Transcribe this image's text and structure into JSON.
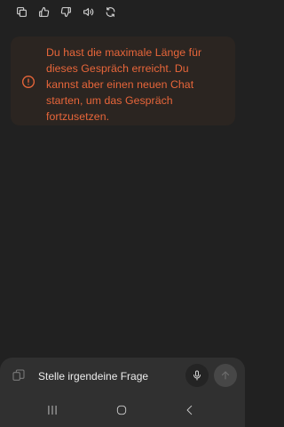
{
  "toolbar": {
    "icons": [
      "copy-icon",
      "thumbs-up-icon",
      "thumbs-down-icon",
      "speaker-icon",
      "regenerate-icon"
    ]
  },
  "warning": {
    "icon": "alert-circle-icon",
    "text": "Du hast die maximale Länge für dieses Gespräch erreicht. Du kannst aber einen neuen Chat starten, um das Gespräch fortzusetzen.",
    "color": "#e8663a"
  },
  "composer": {
    "placeholder": "Stelle irgendeine Frage",
    "value": ""
  },
  "navbar": {
    "icons": [
      "recents-icon",
      "home-icon",
      "back-icon"
    ]
  }
}
